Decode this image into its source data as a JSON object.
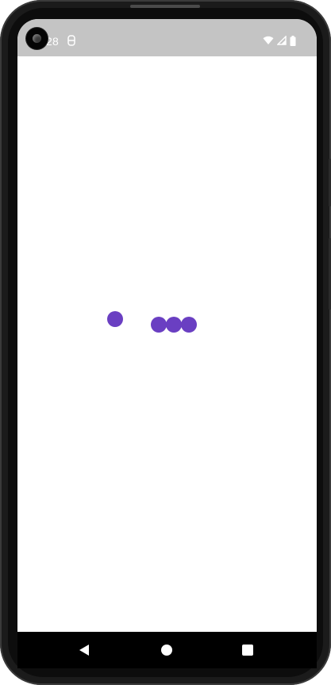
{
  "status_bar": {
    "time": "28",
    "background_color": "#c4c4c4",
    "icons": [
      "notification-icon",
      "wifi-icon",
      "cellular-signal-icon",
      "battery-icon"
    ]
  },
  "content": {
    "background_color": "#ffffff",
    "loader": {
      "accent_color": "#6a3fc2",
      "dot_count": 4
    }
  },
  "nav_bar": {
    "background_color": "#000000",
    "buttons": [
      "back-icon",
      "home-icon",
      "recents-icon"
    ]
  }
}
